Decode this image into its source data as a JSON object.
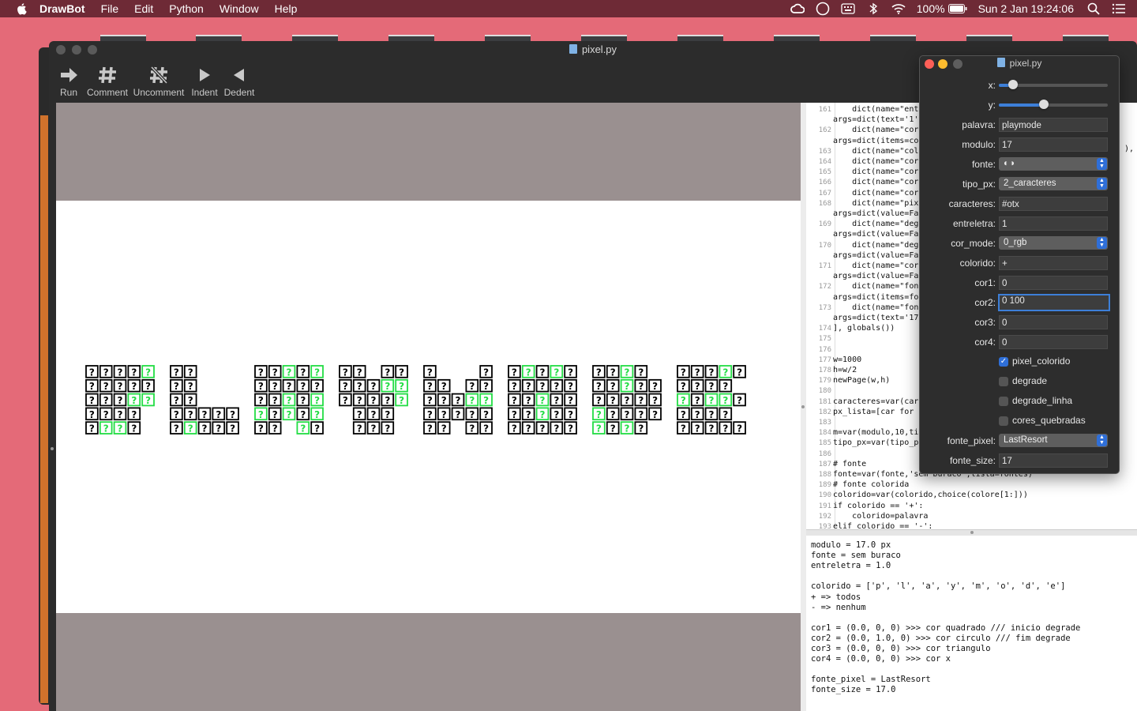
{
  "menubar": {
    "app_name": "DrawBot",
    "menus": [
      "File",
      "Edit",
      "Python",
      "Window",
      "Help"
    ],
    "battery": "100%",
    "clock": "Sun 2 Jan  19:24:06",
    "status_icons": [
      "creative-cloud-icon",
      "circle-icon",
      "keyboard-icon",
      "bluetooth-icon",
      "wifi-icon",
      "battery-icon",
      "search-icon",
      "list-icon"
    ]
  },
  "window": {
    "title": "pixel.py",
    "toolbar": {
      "run": "Run",
      "comment": "Comment",
      "uncomment": "Uncomment",
      "indent": "Indent",
      "dedent": "Dedent"
    }
  },
  "canvas": {
    "text": "playmode",
    "glyph": "?",
    "color_normal": "#000000",
    "color_accent": "#22dd44"
  },
  "editor": {
    "lines": [
      {
        "n": "161",
        "text": "    dict(name=\"ent"
      },
      {
        "n": "",
        "text": "args=dict(text='1'"
      },
      {
        "n": "162",
        "text": "    dict(name=\"cor"
      },
      {
        "n": "",
        "text": "args=dict(items=co"
      },
      {
        "n": "163",
        "text": "    dict(name=\"col"
      },
      {
        "n": "164",
        "text": "    dict(name=\"cor"
      },
      {
        "n": "165",
        "text": "    dict(name=\"cor"
      },
      {
        "n": "166",
        "text": "    dict(name=\"cor"
      },
      {
        "n": "167",
        "text": "    dict(name=\"cor"
      },
      {
        "n": "168",
        "text": "    dict(name=\"pix"
      },
      {
        "n": "",
        "text": "args=dict(value=Fa"
      },
      {
        "n": "169",
        "text": "    dict(name=\"deg"
      },
      {
        "n": "",
        "text": "args=dict(value=Fa"
      },
      {
        "n": "170",
        "text": "    dict(name=\"deg"
      },
      {
        "n": "",
        "text": "args=dict(value=Fa"
      },
      {
        "n": "171",
        "text": "    dict(name=\"cor"
      },
      {
        "n": "",
        "text": "args=dict(value=Fa"
      },
      {
        "n": "172",
        "text": "    dict(name=\"fon"
      },
      {
        "n": "",
        "text": "args=dict(items=fo"
      },
      {
        "n": "173",
        "text": "    dict(name=\"fon"
      },
      {
        "n": "",
        "text": "args=dict(text='17"
      },
      {
        "n": "174",
        "text": "], globals())"
      },
      {
        "n": "175",
        "text": ""
      },
      {
        "n": "176",
        "text": ""
      },
      {
        "n": "177",
        "text": "w=1000"
      },
      {
        "n": "178",
        "text": "h=w/2"
      },
      {
        "n": "179",
        "text": "newPage(w,h)"
      },
      {
        "n": "180",
        "text": ""
      },
      {
        "n": "181",
        "text": "caracteres=var(car"
      },
      {
        "n": "182",
        "text": "px_lista=[car for "
      },
      {
        "n": "183",
        "text": ""
      },
      {
        "n": "184",
        "text": "m=var(modulo,10,ti"
      },
      {
        "n": "185",
        "text": "tipo_px=var(tipo_p"
      },
      {
        "n": "186",
        "text": ""
      },
      {
        "n": "187",
        "text": "# fonte"
      },
      {
        "n": "188",
        "text": "fonte=var(fonte,'sem buraco',lista=fontes)"
      },
      {
        "n": "189",
        "text": "# fonte colorida"
      },
      {
        "n": "190",
        "text": "colorido=var(colorido,choice(colore[1:]))"
      },
      {
        "n": "191",
        "text": "if colorido == '+':"
      },
      {
        "n": "192",
        "text": "    colorido=palavra"
      },
      {
        "n": "193",
        "text": "elif colorido == '-':"
      }
    ],
    "overflow_text": "),"
  },
  "output": {
    "lines": [
      "modulo = 17.0 px",
      "fonte = sem buraco",
      "entreletra = 1.0",
      "",
      "colorido = ['p', 'l', 'a', 'y', 'm', 'o', 'd', 'e']",
      "+ => todos",
      "- => nenhum",
      "",
      "cor1 = (0.0, 0, 0) >>> cor quadrado /// inicio degrade",
      "cor2 = (0.0, 1.0, 0) >>> cor circulo /// fim degrade",
      "cor3 = (0.0, 0, 0) >>> cor triangulo",
      "cor4 = (0.0, 0, 0) >>> cor x",
      "",
      "fonte_pixel = LastResort",
      "fonte_size = 17.0"
    ]
  },
  "panel": {
    "title": "pixel.py",
    "x_label": "x:",
    "x_value": 0.13,
    "y_label": "y:",
    "y_value": 0.41,
    "palavra_label": "palavra:",
    "palavra": "playmode",
    "modulo_label": "modulo:",
    "modulo": "17",
    "fonte_label": "fonte:",
    "fonte": "◐◑",
    "tipo_px_label": "tipo_px:",
    "tipo_px": "2_caracteres",
    "caracteres_label": "caracteres:",
    "caracteres": "#otx",
    "entreletra_label": "entreletra:",
    "entreletra": "1",
    "cor_mode_label": "cor_mode:",
    "cor_mode": "0_rgb",
    "colorido_label": "colorido:",
    "colorido": "+",
    "cor1_label": "cor1:",
    "cor1": "0",
    "cor2_label": "cor2:",
    "cor2": "0 100",
    "cor3_label": "cor3:",
    "cor3": "0",
    "cor4_label": "cor4:",
    "cor4": "0",
    "checkboxes": [
      {
        "label": "pixel_colorido",
        "checked": true
      },
      {
        "label": "degrade",
        "checked": false
      },
      {
        "label": "degrade_linha",
        "checked": false
      },
      {
        "label": "cores_quebradas",
        "checked": false
      }
    ],
    "fonte_pixel_label": "fonte_pixel:",
    "fonte_pixel": "LastResort",
    "fonte_size_label": "fonte_size:",
    "fonte_size": "17"
  }
}
